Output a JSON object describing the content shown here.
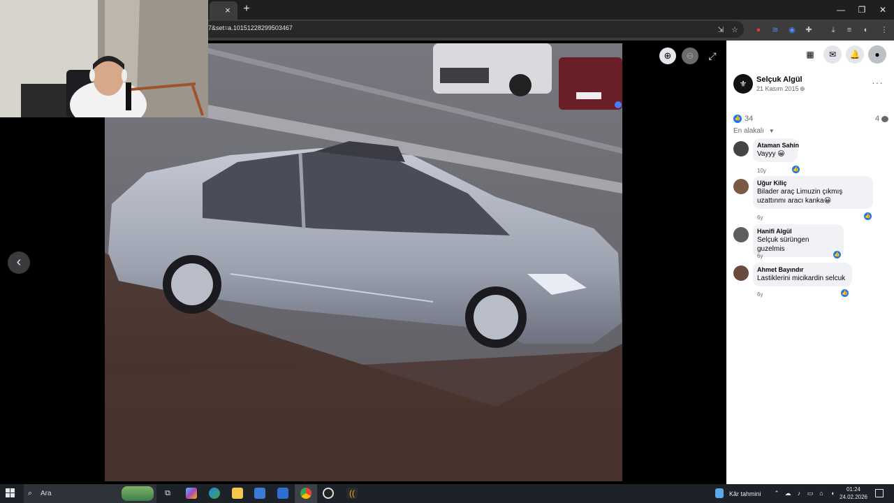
{
  "browser": {
    "close_tab_glyph": "×",
    "new_tab_glyph": "+",
    "url_fragment": "7&set=a.10151228299503467",
    "window_controls": [
      "—",
      "❐",
      "✕"
    ]
  },
  "viewer": {
    "prev_glyph": "‹",
    "zoom_in_glyph": "⊕",
    "zoom_out_glyph": "⊖",
    "fullscreen_glyph": "⤢"
  },
  "post": {
    "author": "Selçuk Algül",
    "date": "21 Kasım 2015",
    "globe_glyph": "⊕",
    "more_glyph": "···",
    "likes": "34",
    "comments": "4",
    "sort_label": "En alakalı",
    "sort_arrow": "▼"
  },
  "comments": [
    {
      "name": "Ataman Sahin",
      "text": "Vayyy 😀",
      "time": "10y"
    },
    {
      "name": "Uğur Kiliç",
      "text": "Bilader araç Limuzin çıkmış uzattınmı aracı kanka😀",
      "time": "6y"
    },
    {
      "name": "Hanifi Algül",
      "text": "Selçuk sürüngen guzelmis",
      "time": "6y"
    },
    {
      "name": "Ahmet Bayındır",
      "text": "Lastiklerini micikardin selcuk",
      "time": "6y"
    }
  ],
  "taskbar": {
    "search_placeholder": "Ara",
    "weather": "Kâr tahmini",
    "time": "01:24",
    "date": "24.02.2026"
  },
  "colors": {
    "accent": "#1877f2",
    "panel_bg": "#ffffff",
    "bubble_bg": "#f0f2f5",
    "taskbar_bg": "#1c2227"
  }
}
